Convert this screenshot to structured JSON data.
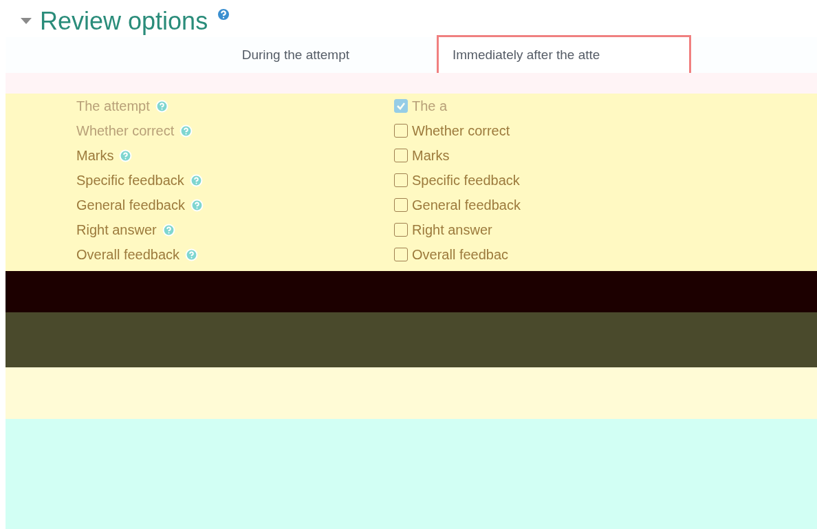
{
  "section": {
    "title": "Review options",
    "expanded": true
  },
  "columns": [
    {
      "heading": "During the attempt",
      "highlighted": false
    },
    {
      "heading": "Immediately after the atte",
      "highlighted": true
    }
  ],
  "during": [
    {
      "label": "The attempt",
      "disabled": true
    },
    {
      "label": "Whether correct",
      "disabled": true
    },
    {
      "label": "Marks",
      "disabled": false
    },
    {
      "label": "Specific feedback",
      "disabled": false
    },
    {
      "label": "General feedback",
      "disabled": false
    },
    {
      "label": "Right answer",
      "disabled": false
    },
    {
      "label": "Overall feedback",
      "disabled": false
    }
  ],
  "immediately": [
    {
      "label": "The a",
      "checked": true,
      "disabled": true
    },
    {
      "label": "Whether correct",
      "checked": false,
      "disabled": false
    },
    {
      "label": "Marks",
      "checked": false,
      "disabled": false
    },
    {
      "label": "Specific feedback",
      "checked": false,
      "disabled": false
    },
    {
      "label": "General feedback",
      "checked": false,
      "disabled": false
    },
    {
      "label": "Right answer",
      "checked": false,
      "disabled": false
    },
    {
      "label": "Overall feedbac",
      "checked": false,
      "disabled": false
    }
  ]
}
